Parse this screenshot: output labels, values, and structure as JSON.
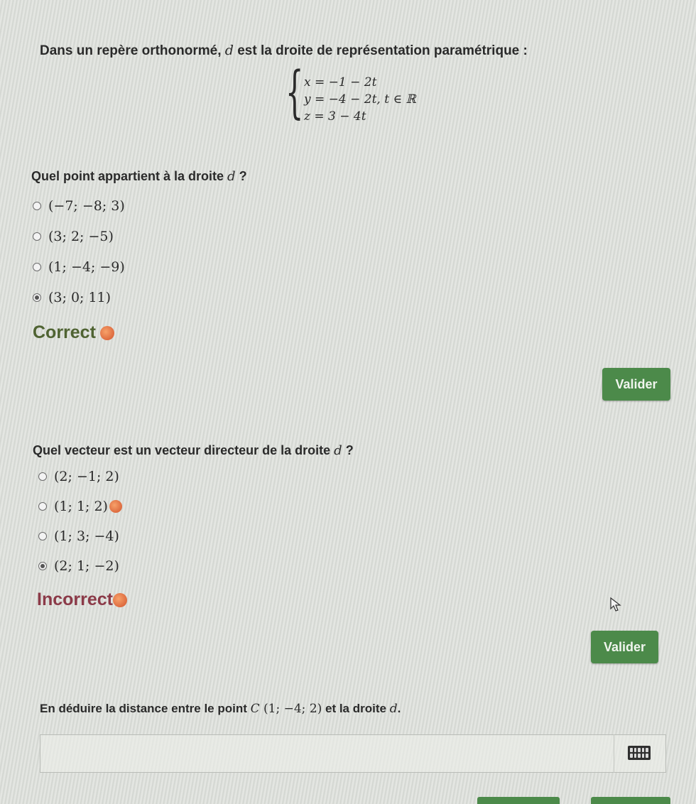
{
  "intro": {
    "before": "Dans un repère orthonormé, ",
    "var": "d",
    "after": " est la droite de représentation paramétrique :"
  },
  "system": {
    "equations": [
      "x = −1 − 2t",
      "y = −4 − 2t, t ∈ ℝ",
      "z = 3 − 4t"
    ]
  },
  "question1": {
    "title_before": "Quel point appartient à la droite ",
    "title_var": "d",
    "title_after": " ?",
    "options": [
      "(−7; −8; 3)",
      "(3; 2; −5)",
      "(1; −4; −9)",
      "(3; 0; 11)"
    ],
    "selected_index": 3,
    "feedback": "Correct",
    "button": "Valider"
  },
  "question2": {
    "title_before": "Quel vecteur est un vecteur directeur de la droite ",
    "title_var": "d",
    "title_after": " ?",
    "options": [
      "(2; −1; 2)",
      "(1; 1; 2)",
      "(1; 3; −4)",
      "(2; 1; −2)"
    ],
    "selected_index": 3,
    "feedback": "Incorrect",
    "button": "Valider"
  },
  "question3": {
    "text_before": "En déduire la distance entre le point ",
    "point_name": "C",
    "point_coords": " (1; −4; 2)",
    "text_after": " et la droite ",
    "var": "d",
    "end": ".",
    "answer_value": ""
  },
  "colors": {
    "button_green": "#4c8a4a",
    "correct_text": "#4f6332",
    "incorrect_text": "#8b3a48",
    "badge_orange": "#d2542d"
  }
}
